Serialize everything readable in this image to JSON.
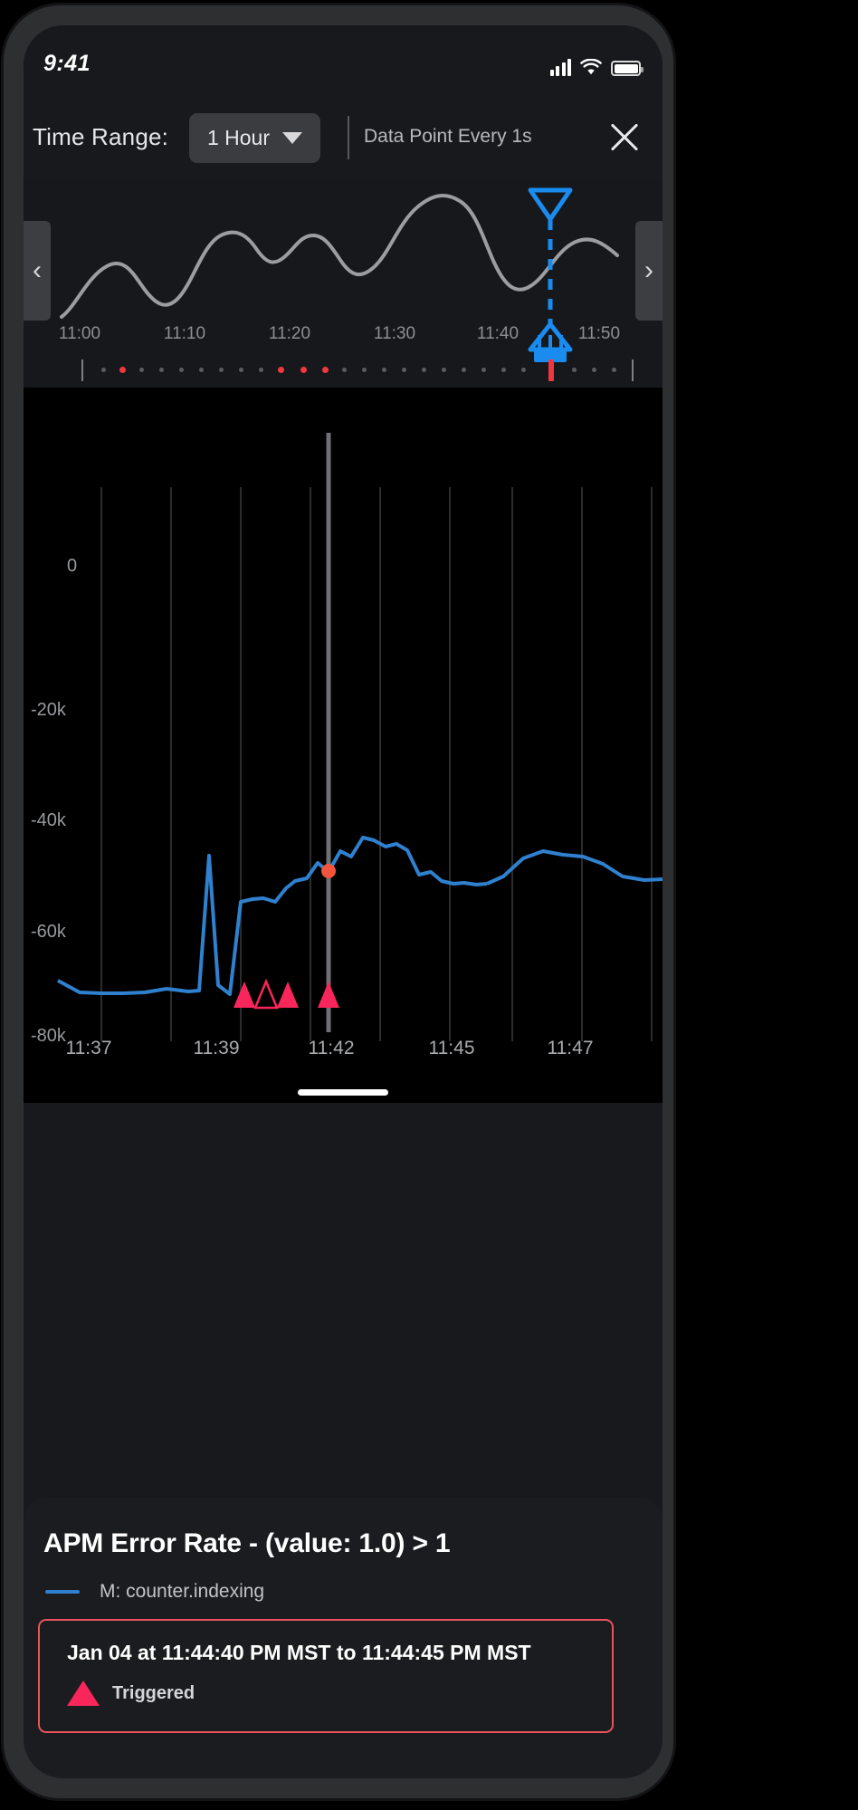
{
  "status_bar": {
    "time": "9:41",
    "cellular_icon": "cellular-signal-icon",
    "wifi_icon": "wifi-icon",
    "battery_icon": "battery-full-icon"
  },
  "toolbar": {
    "time_range_label": "Time Range:",
    "time_range_value": "1 Hour",
    "time_range_options": [
      "1 Hour"
    ],
    "caret_icon": "chevron-down-icon",
    "data_point_interval": "Data Point Every 1s",
    "close_icon": "close-icon"
  },
  "navigator": {
    "prev_arrow": "‹",
    "next_arrow": "›",
    "ticks": [
      "11:00",
      "11:10",
      "11:20",
      "11:30",
      "11:40",
      "11:50"
    ],
    "playhead_icon": "playhead-marker-icon"
  },
  "chart_data": {
    "type": "line",
    "title": "APM Error Rate - (value: 1.0) > 1",
    "xlabel": "",
    "ylabel": "",
    "ylim": [
      -80000,
      10000
    ],
    "y_ticks": [
      "0",
      "-20k",
      "-40k",
      "-60k",
      "-80k"
    ],
    "y_tick_values": [
      0,
      -20000,
      -40000,
      -60000,
      -80000
    ],
    "x_ticks": [
      "11:37",
      "11:39",
      "11:42",
      "11:45",
      "11:47"
    ],
    "grid": true,
    "legend": [
      {
        "name": "M: counter.indexing",
        "color": "#2f81cf"
      }
    ],
    "series": [
      {
        "name": "M: counter.indexing",
        "color": "#2f81cf",
        "values": [
          -61500,
          -63500,
          -63800,
          -63700,
          -63600,
          -62900,
          -63400,
          -63300,
          -41500,
          -62000,
          -63900,
          -52000,
          -51500,
          -51400,
          -52000,
          -50000,
          -48500,
          -48000,
          -44000,
          -46000,
          -41200,
          -42000,
          -39000,
          -39500,
          -40500,
          -40000,
          -41000,
          -44500,
          -44000,
          -45500,
          -45800
        ]
      }
    ],
    "annotations": {
      "cursor_line_x": "11:42",
      "cursor_point_value": -51000,
      "cursor_point_color": "#f2543d",
      "triggered_markers": [
        {
          "x": "11:38.6",
          "filled": true
        },
        {
          "x": "11:39.1",
          "filled": false
        },
        {
          "x": "11:39.6",
          "filled": true
        },
        {
          "x": "11:41.9",
          "filled": true
        }
      ],
      "marker_color": "#f9265b"
    }
  },
  "detail": {
    "title": "APM Error Rate - (value: 1.0) > 1",
    "legend_label": "M: counter.indexing",
    "legend_color": "#2f81cf",
    "alert_time_range": "Jan 04 at 11:44:40 PM MST to 11:44:45 PM MST",
    "alert_status": "Triggered",
    "alert_border_color": "#e8535d",
    "alert_icon": "triangle-alert-icon"
  }
}
